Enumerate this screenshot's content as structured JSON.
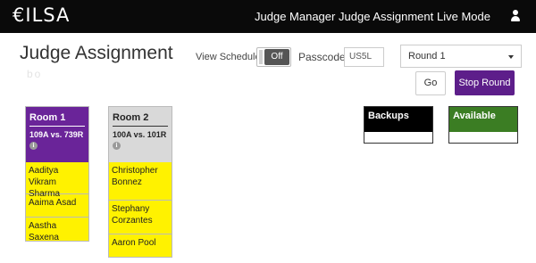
{
  "header": {
    "logo": "ILSA",
    "nav": [
      {
        "label": "Judge Manager"
      },
      {
        "label": "Judge Assignment"
      },
      {
        "label": "Live Mode"
      }
    ]
  },
  "page": {
    "title": "Judge Assignment",
    "subtitle": "bo"
  },
  "controls": {
    "view_schedule_label": "View Schedule",
    "toggle_value": "Off",
    "passcode_label": "Passcode",
    "passcode_value": "US5L",
    "round_selected": "Round 1",
    "go_label": "Go",
    "stop_label": "Stop Round"
  },
  "rooms": [
    {
      "name": "Room 1",
      "matchup": "109A vs. 739R",
      "color": "#6a2499",
      "judges": [
        "Aaditya Vikram Sharma",
        "Aaima Asad",
        "Aastha Saxena"
      ]
    },
    {
      "name": "Room 2",
      "matchup": "100A vs. 101R",
      "color": "#d9d9d9",
      "judges": [
        "Christopher Bonnez",
        "Stephany Corzantes",
        "Aaron Pool"
      ]
    }
  ],
  "pools": {
    "backups": {
      "label": "Backups",
      "color": "#000000"
    },
    "available": {
      "label": "Available",
      "color": "#3b7d23"
    }
  },
  "colors": {
    "topbar": "#0a0a0a",
    "judge_highlight": "#fff200",
    "stop_button": "#5d1e8a"
  },
  "icons": {
    "user": "user-icon",
    "info": "info-icon",
    "caret": "chevron-down-icon"
  }
}
